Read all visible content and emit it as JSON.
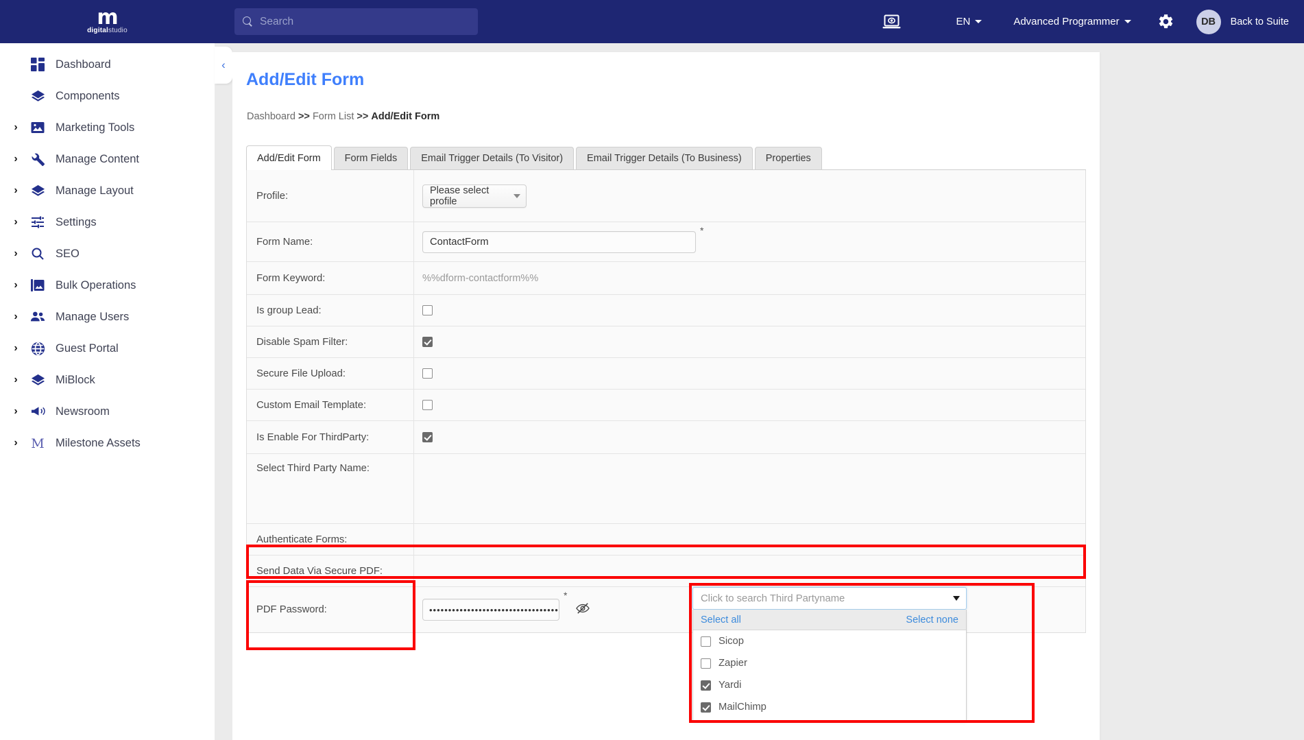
{
  "topbar": {
    "logo_mark": "m",
    "logo_bold": "digital",
    "logo_light": "studio",
    "search_placeholder": "Search",
    "preview_icon": "screen-preview-icon",
    "language": "EN",
    "user_menu": "Advanced Programmer",
    "settings_icon": "gear-icon",
    "avatar_initials": "DB",
    "back_to_suite": "Back to Suite"
  },
  "sidebar": {
    "collapse_icon": "chevron-left-icon",
    "items": [
      {
        "label": "Dashboard",
        "icon": "dashboard-grid-icon",
        "expandable": false
      },
      {
        "label": "Components",
        "icon": "layers-icon",
        "expandable": false
      },
      {
        "label": "Marketing Tools",
        "icon": "image-icon",
        "expandable": true
      },
      {
        "label": "Manage Content",
        "icon": "wrench-icon",
        "expandable": true
      },
      {
        "label": "Manage Layout",
        "icon": "layers-icon",
        "expandable": true
      },
      {
        "label": "Settings",
        "icon": "sliders-icon",
        "expandable": true
      },
      {
        "label": "SEO",
        "icon": "search-icon",
        "expandable": true
      },
      {
        "label": "Bulk Operations",
        "icon": "multi-image-icon",
        "expandable": true
      },
      {
        "label": "Manage Users",
        "icon": "users-icon",
        "expandable": true
      },
      {
        "label": "Guest Portal",
        "icon": "globe-icon",
        "expandable": true
      },
      {
        "label": "MiBlock",
        "icon": "layers-icon",
        "expandable": true
      },
      {
        "label": "Newsroom",
        "icon": "megaphone-icon",
        "expandable": true
      },
      {
        "label": "Milestone Assets",
        "icon": "milestone-m-icon",
        "expandable": true
      }
    ]
  },
  "page": {
    "title": "Add/Edit Form",
    "breadcrumb": {
      "first": "Dashboard",
      "sep": ">>",
      "second": "Form List",
      "current": "Add/Edit Form"
    }
  },
  "tabs": [
    {
      "label": "Add/Edit Form",
      "active": true
    },
    {
      "label": "Form Fields",
      "active": false
    },
    {
      "label": "Email Trigger Details (To Visitor)",
      "active": false
    },
    {
      "label": "Email Trigger Details (To Business)",
      "active": false
    },
    {
      "label": "Properties",
      "active": false
    }
  ],
  "form": {
    "profile": {
      "label": "Profile:",
      "value": "Please select profile"
    },
    "form_name": {
      "label": "Form Name:",
      "value": "ContactForm",
      "required_mark": "*"
    },
    "form_keyword": {
      "label": "Form Keyword:",
      "value": "%%dform-contactform%%"
    },
    "is_group_lead": {
      "label": "Is group Lead:",
      "checked": false
    },
    "disable_spam_filter": {
      "label": "Disable Spam Filter:",
      "checked": true
    },
    "secure_file_upload": {
      "label": "Secure File Upload:",
      "checked": false
    },
    "custom_email_template": {
      "label": "Custom Email Template:",
      "checked": false
    },
    "is_enable_thirdparty": {
      "label": "Is Enable For ThirdParty:",
      "checked": true
    },
    "select_third_party": {
      "label": "Select Third Party Name:",
      "placeholder": "Click to search Third Partyname",
      "select_all": "Select all",
      "select_none": "Select none",
      "options": [
        {
          "label": "Sicop",
          "checked": false
        },
        {
          "label": "Zapier",
          "checked": false
        },
        {
          "label": "Yardi",
          "checked": true
        },
        {
          "label": "MailChimp",
          "checked": true
        }
      ]
    },
    "authenticate_forms": {
      "label": "Authenticate Forms:"
    },
    "send_data_secure_pdf": {
      "label": "Send Data Via Secure PDF:"
    },
    "pdf_password": {
      "label": "PDF Password:",
      "value": "••••••••••••••••••••••••••••••••••",
      "required_mark": "*",
      "toggle_icon": "eye-off-icon"
    }
  },
  "colors": {
    "brand_navy": "#1e2673",
    "accent_blue": "#3f7ffc",
    "highlight_red": "#fb0000",
    "link_blue": "#3d8bdc"
  }
}
